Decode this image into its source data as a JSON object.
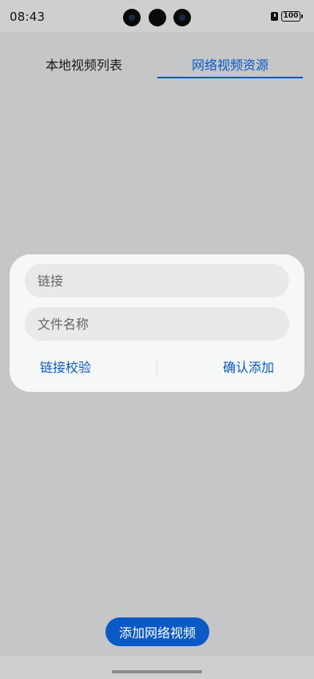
{
  "status_bar": {
    "time": "08:43",
    "battery": "100",
    "icons": [
      "front-camera-icon",
      "front-camera-icon",
      "front-camera-icon",
      "alert-icon",
      "battery-icon"
    ]
  },
  "tabs": [
    {
      "label": "本地视频列表",
      "active": false
    },
    {
      "label": "网络视频资源",
      "active": true
    }
  ],
  "dialog": {
    "link_placeholder": "链接",
    "name_placeholder": "文件名称",
    "verify_label": "链接校验",
    "confirm_label": "确认添加"
  },
  "add_button_label": "添加网络视频",
  "colors": {
    "accent": "#0a59c7",
    "background": "#c4c6c8",
    "dialog_bg": "#f6f7f7",
    "field_bg": "#e8e9e9"
  }
}
